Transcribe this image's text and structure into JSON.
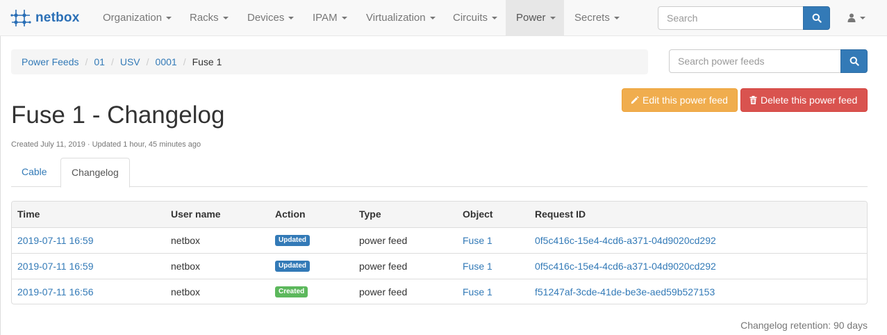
{
  "brand": {
    "name": "netbox"
  },
  "nav": {
    "items": [
      {
        "label": "Organization",
        "active": false
      },
      {
        "label": "Racks",
        "active": false
      },
      {
        "label": "Devices",
        "active": false
      },
      {
        "label": "IPAM",
        "active": false
      },
      {
        "label": "Virtualization",
        "active": false
      },
      {
        "label": "Circuits",
        "active": false
      },
      {
        "label": "Power",
        "active": true
      },
      {
        "label": "Secrets",
        "active": false
      }
    ],
    "search_placeholder": "Search",
    "user_icon": "user-icon"
  },
  "breadcrumb": {
    "items": [
      {
        "label": "Power Feeds",
        "link": true
      },
      {
        "label": "01",
        "link": true
      },
      {
        "label": "USV",
        "link": true
      },
      {
        "label": "0001",
        "link": true
      },
      {
        "label": "Fuse 1",
        "link": false
      }
    ]
  },
  "feed_search": {
    "placeholder": "Search power feeds"
  },
  "actions": {
    "edit_label": "Edit this power feed",
    "delete_label": "Delete this power feed"
  },
  "page": {
    "title": "Fuse 1 - Changelog",
    "meta": "Created July 11, 2019 · Updated 1 hour, 45 minutes ago"
  },
  "tabs": [
    {
      "label": "Cable",
      "active": false
    },
    {
      "label": "Changelog",
      "active": true
    }
  ],
  "table": {
    "headers": [
      "Time",
      "User name",
      "Action",
      "Type",
      "Object",
      "Request ID"
    ],
    "rows": [
      {
        "time": "2019-07-11 16:59",
        "user": "netbox",
        "action": "Updated",
        "action_color": "#337ab7",
        "type": "power feed",
        "object": "Fuse 1",
        "request_id": "0f5c416c-15e4-4cd6-a371-04d9020cd292"
      },
      {
        "time": "2019-07-11 16:59",
        "user": "netbox",
        "action": "Updated",
        "action_color": "#337ab7",
        "type": "power feed",
        "object": "Fuse 1",
        "request_id": "0f5c416c-15e4-4cd6-a371-04d9020cd292"
      },
      {
        "time": "2019-07-11 16:56",
        "user": "netbox",
        "action": "Created",
        "action_color": "#5cb85c",
        "type": "power feed",
        "object": "Fuse 1",
        "request_id": "f51247af-3cde-41de-be3e-aed59b527153"
      }
    ]
  },
  "footer": {
    "retention": "Changelog retention: 90 days"
  },
  "colors": {
    "primary": "#337ab7",
    "warning": "#f0ad4e",
    "danger": "#d9534f",
    "success": "#5cb85c"
  }
}
